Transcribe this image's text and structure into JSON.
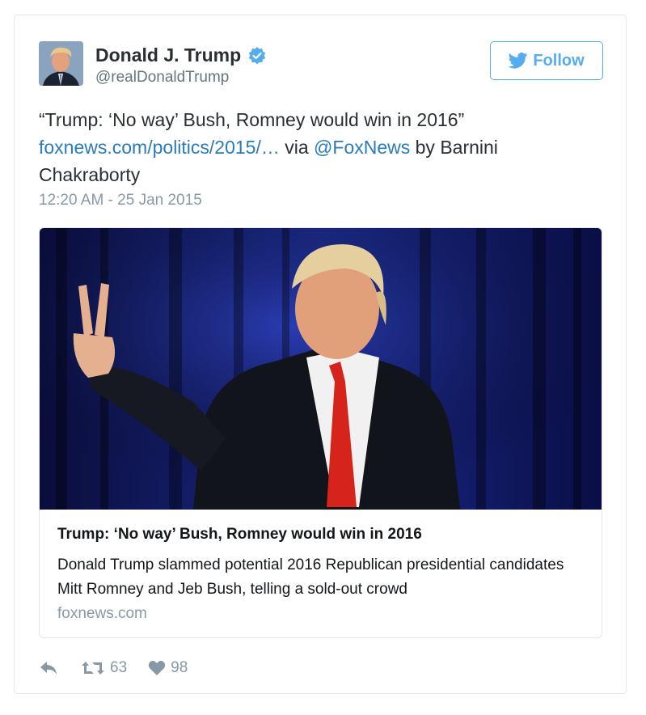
{
  "author": {
    "name": "Donald J. Trump",
    "handle": "@realDonaldTrump",
    "verified": true
  },
  "follow_button": {
    "label": "Follow",
    "icon": "twitter-bird-icon"
  },
  "tweet": {
    "text_part1": "“Trump: ‘No way’ Bush, Romney would win in 2016”",
    "link": "foxnews.com/politics/2015/…",
    "via": " via ",
    "mention": "@FoxNews",
    "text_part2": " by Barnini Chakraborty",
    "timestamp": "12:20 AM - 25 Jan 2015"
  },
  "card": {
    "title": "Trump: ‘No way’ Bush, Romney would win in 2016",
    "description": "Donald Trump slammed potential 2016 Republican presidential candidates Mitt Romney and Jeb Bush, telling a sold-out crowd",
    "domain": "foxnews.com"
  },
  "actions": {
    "reply_icon": "reply-icon",
    "retweet_icon": "retweet-icon",
    "retweet_count": "63",
    "like_icon": "heart-icon",
    "like_count": "98"
  },
  "colors": {
    "link": "#2b7bb9",
    "follow_accent": "#55acee",
    "muted": "#8899a6",
    "verified": "#55acee"
  }
}
